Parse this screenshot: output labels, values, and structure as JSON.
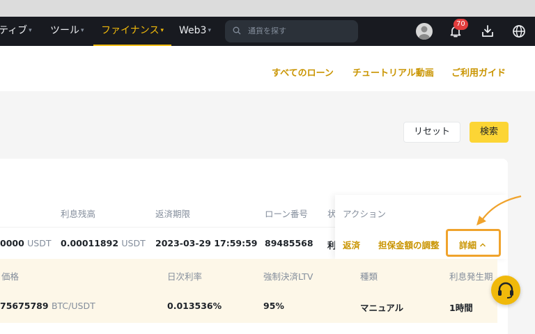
{
  "nav": {
    "items": [
      {
        "label": "ティブ",
        "caret": "▾"
      },
      {
        "label": "ツール",
        "caret": "▾"
      },
      {
        "label": "ファイナンス",
        "caret": "▾"
      },
      {
        "label": "Web3",
        "caret": "▾"
      }
    ],
    "search_placeholder": "通貨を探す",
    "notification_count": "70"
  },
  "header_links": [
    "すべてのローン",
    "チュートリアル動画",
    "ご利用ガイド"
  ],
  "filters": {
    "reset_label": "リセット",
    "search_label": "検索"
  },
  "table": {
    "headers": {
      "interest_balance": "利息残高",
      "due_date": "返済期限",
      "loan_no": "ローン番号",
      "status": "状",
      "action": "アクション"
    },
    "row": {
      "amount": "0000",
      "amount_unit": "USDT",
      "interest": "0.00011892",
      "interest_unit": "USDT",
      "due": "2023-03-29 17:59:59",
      "loan_no": "89485568",
      "status": "利"
    },
    "actions": {
      "repay": "返済",
      "adjust": "担保金額の調整",
      "detail": "詳細",
      "detail_chevron": "^"
    }
  },
  "expanded": {
    "headers": {
      "price": "価格",
      "daily_rate": "日次利率",
      "liq_ltv": "強制決済LTV",
      "type": "種類",
      "interest_period": "利息発生期"
    },
    "values": {
      "price": "75675789",
      "price_unit": "BTC/USDT",
      "daily_rate": "0.013536%",
      "liq_ltv": "95%",
      "type": "マニュアル",
      "interest_period": "1時間"
    }
  },
  "colors": {
    "accent": "#f0b90b",
    "link": "#c99400",
    "highlight": "#f0a32c",
    "nav_bg": "#181a20"
  }
}
